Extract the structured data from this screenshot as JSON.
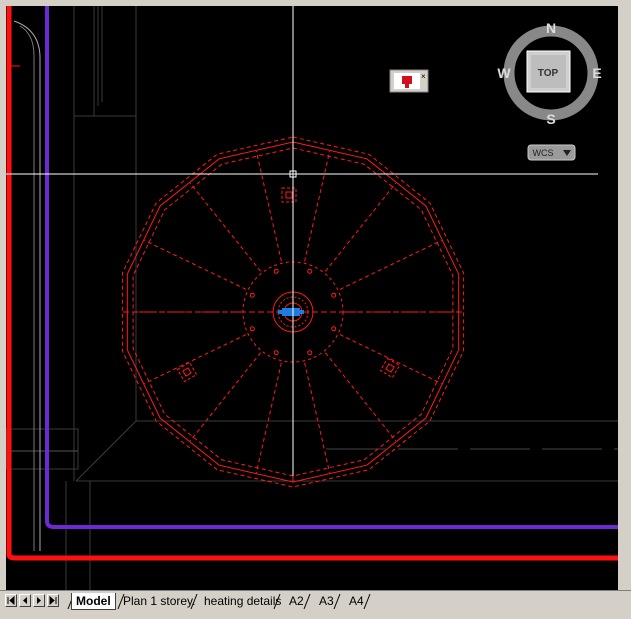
{
  "viewcube": {
    "north": "N",
    "south": "S",
    "east": "E",
    "west": "W",
    "face": "TOP",
    "ucs": "WCS"
  },
  "tabs": [
    {
      "label": "Model",
      "active": true
    },
    {
      "label": "Plan 1 storey.",
      "active": false
    },
    {
      "label": "heating details",
      "active": false
    },
    {
      "label": "A2",
      "active": false
    },
    {
      "label": "A3",
      "active": false
    },
    {
      "label": "A4",
      "active": false
    }
  ],
  "colors": {
    "background": "#000000",
    "primary_lines": "#ff1a1a",
    "wall_line": "#7a2cc8",
    "grip": "#1e7be0",
    "crosshair": "#ffffff"
  },
  "icons": [
    "first-tab-icon",
    "prev-tab-icon",
    "next-tab-icon",
    "last-tab-icon",
    "lock-badge-icon",
    "crosshair-icon"
  ]
}
